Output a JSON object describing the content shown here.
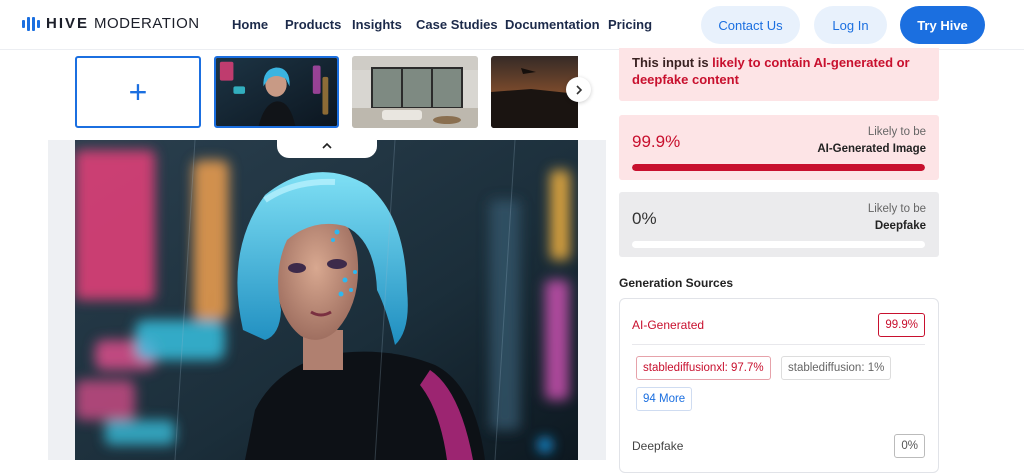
{
  "header": {
    "logo_bold": "HIVE",
    "logo_rest": "MODERATION",
    "nav": [
      "Home",
      "Products",
      "Insights",
      "Case Studies",
      "Documentation",
      "Pricing"
    ],
    "contact_label": "Contact Us",
    "login_label": "Log In",
    "try_label": "Try Hive"
  },
  "gallery": {
    "add_symbol": "+",
    "thumbnails": [
      "neon-portrait",
      "modern-interior",
      "dusk-sky"
    ],
    "selected_index": 0
  },
  "result": {
    "alert_prefix": "This input is ",
    "alert_highlight": "likely to contain AI-generated or deepfake content",
    "ai_score": "99.9%",
    "ai_fill": 0.999,
    "ai_label_top": "Likely to be",
    "ai_label_bottom": "AI-Generated Image",
    "df_score": "0%",
    "df_fill": 0,
    "df_label_top": "Likely to be",
    "df_label_bottom": "Deepfake"
  },
  "sources": {
    "title": "Generation Sources",
    "ai_label": "AI-Generated",
    "ai_value": "99.9%",
    "chips": [
      "stablediffusionxl: 97.7%",
      "stablediffusion: 1%"
    ],
    "more_label": "94 More",
    "df_label": "Deepfake",
    "df_value": "0%"
  },
  "colors": {
    "accent": "#1b6fe0",
    "alert_red": "#c8102e",
    "alert_bg": "#fde4e6"
  }
}
